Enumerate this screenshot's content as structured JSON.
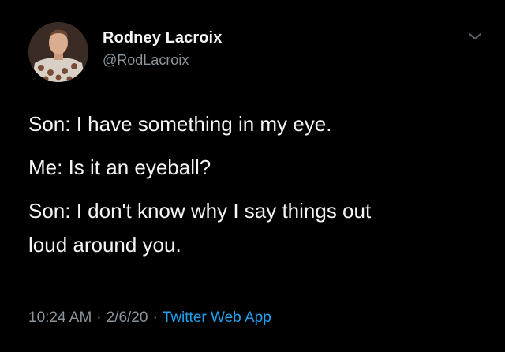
{
  "user": {
    "display_name": "Rodney Lacroix",
    "handle": "@RodLacroix"
  },
  "tweet": {
    "lines": [
      "Son: I have something in my eye.",
      "Me: Is it an eyeball?",
      "Son: I don't know why I say things out",
      "loud around you."
    ],
    "time": "10:24 AM",
    "separator": "·",
    "date": "2/6/20",
    "source": "Twitter Web App"
  },
  "icons": {
    "menu": "chevron-down-icon",
    "avatar": "profile-photo"
  },
  "colors": {
    "background": "#000000",
    "text": "#f5f5f5",
    "muted": "#8b959e",
    "link": "#1da1f2"
  }
}
